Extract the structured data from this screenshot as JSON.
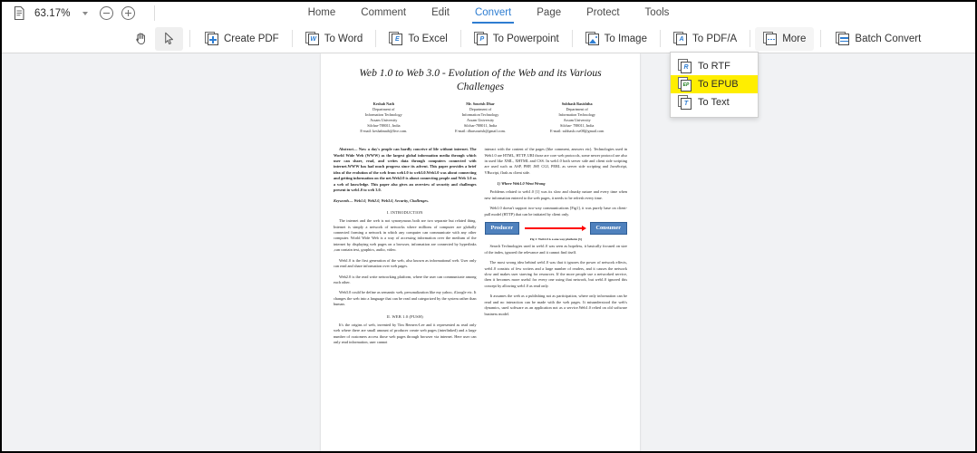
{
  "topbar": {
    "doc_icon": "document-icon",
    "zoom_level": "63.17%",
    "zoom_dropdown_icon": "chevron-down-icon",
    "zoom_out_icon": "zoom-out-icon",
    "zoom_in_icon": "zoom-in-icon",
    "menu": [
      {
        "label": "Home",
        "active": false
      },
      {
        "label": "Comment",
        "active": false
      },
      {
        "label": "Edit",
        "active": false
      },
      {
        "label": "Convert",
        "active": true
      },
      {
        "label": "Page",
        "active": false
      },
      {
        "label": "Protect",
        "active": false
      },
      {
        "label": "Tools",
        "active": false
      }
    ]
  },
  "ribbon": {
    "hand_tool": "hand-tool-icon",
    "select_tool": "select-pointer-icon",
    "buttons": [
      {
        "label": "Create PDF",
        "icon": "create-pdf-icon",
        "glyph": "+"
      },
      {
        "label": "To Word",
        "icon": "to-word-icon",
        "glyph": "W"
      },
      {
        "label": "To Excel",
        "icon": "to-excel-icon",
        "glyph": "E"
      },
      {
        "label": "To Powerpoint",
        "icon": "to-powerpoint-icon",
        "glyph": "P"
      },
      {
        "label": "To Image",
        "icon": "to-image-icon",
        "glyph": "img"
      },
      {
        "label": "To PDF/A",
        "icon": "to-pdfa-icon",
        "glyph": "A"
      },
      {
        "label": "More",
        "icon": "more-icon",
        "glyph": "dots"
      },
      {
        "label": "Batch Convert",
        "icon": "batch-convert-icon",
        "glyph": "swap"
      }
    ]
  },
  "dropdown": {
    "open": true,
    "items": [
      {
        "label": "To RTF",
        "icon": "to-rtf-icon",
        "glyph": "R",
        "highlighted": false
      },
      {
        "label": "To EPUB",
        "icon": "to-epub-icon",
        "glyph": "EP",
        "highlighted": true
      },
      {
        "label": "To Text",
        "icon": "to-text-icon",
        "glyph": "T",
        "highlighted": false
      }
    ],
    "highlight_color": "#ffee00"
  },
  "document": {
    "title": "Web 1.0 to Web 3.0 - Evolution of the Web and its Various Challenges",
    "authors": [
      {
        "name": "Keshab Nath",
        "dept1": "Department of",
        "dept2": "Information Technology",
        "university": "Assam University",
        "address": "Silchar-788011, India",
        "email": "E-mail: keshabnath@live.com."
      },
      {
        "name": "Mr. Sourish Dhar",
        "dept1": "Department of",
        "dept2": "Information Technology",
        "university": "Assam University",
        "address": "Silchar-788011, India",
        "email": "E-mail: dharsourish@gmail.com."
      },
      {
        "name": "Subhash Basishtha",
        "dept1": "Department of",
        "dept2": "Information Technology",
        "university": "Assam University",
        "address": "Silchar- 788011, India",
        "email": "E-mail: subhash.cse08@gmail.com"
      }
    ],
    "abstract": "Abstract— Now a day's people can hardly conceive of life without internet. The World Wide Web (WWW) as the largest global information media through which user can share, read, and writes data through computers connected with internet.WWW has had much progress since its advent. This paper provides a brief idea of the evolution of the web from web1.0 to web3.0.Web1.0 was about connecting and getting information on the net.Web2.0 is about connecting people and Web 3.0 as a web of knowledge. This paper also gives an overview of security and challenges present in web1.0 to web 3.0.",
    "keywords": "Keywords— Web1.0, Web2.0, Web3.0, Security, Challenges.",
    "section1": "I.     INTRODUCTION",
    "left_paras": [
      "The internet and the web is not synonymous both are two separate but related thing. Internet is simply a network of networks where millions of computer are globally connected forming a network in which any computer can communicate with any other computer. World Wide Web is a way of accessing information over the medium of the internet by displaying web pages on a browser, information are connected by hyperlinks ,can contain text, graphics, audio, video.",
      "Web1.0 is the first generation of the web, also known as informational web. User only can read and share information over web pages.",
      "Web2.0 is the read write networking platform, where the user can communicate among each other.",
      "Web3.0 could be define as semantic web, personalization like my yahoo, iGoogle etc. It changes the web into a language that can be read and categorized by the system rather than human."
    ],
    "section2": "II.     WEB 1.0 (PUSH)",
    "left_paras_2": [
      "It's the origins of web, invented by Tim Berners-Lee and it represented as read only web where there are small amount of producer create web pages (interlinked) and a large number of customers access those web pages through browser via internet. Here user can only read information, user cannot"
    ],
    "right_paras_1": [
      "interact with the content of the pages (like comment, answers etc). Technologies used in Web1.0 are HTML, HTTP, URI those are core web protocols, some newer protocol are also in used like XML, XHTML and CSS. In web1.0 both server side and client side scripting are used such as ASP, PHP, JSP, CGI, PERL as server side scripting and JavaScript, VBscript, flash as client side."
    ],
    "subsection1": "1)    Where Web1.0 Went Wrong",
    "right_paras_2": [
      "Problems related to web1.0 [1] was its slow and chunky nature and every time when new information entered to the web pages, it needs to be refresh every time.",
      "Web1.0 doesn't support two-way communications [Fig1], it was purely base on client-pull model (HTTP) that can be initiated by client only."
    ],
    "figure": {
      "left_box": "Producer",
      "right_box": "Consumer",
      "arrow": "right-arrow-icon",
      "caption": "Fig 1: Web1.0 is a one-way platform [3]"
    },
    "right_paras_3": [
      "Search Technologies used in web1.0 was seen as hopeless, it basically focused on size of the index, ignored the relevance and it cannot find itself.",
      "The most wrong idea behind web1.0 was that it ignores the power of network effects, web1.0 consists of few writers and a large number of readers, and it causes the network slow and makes user starving for resources. If the more people use a networked service, then it becomes more useful for every one using that network, but web1.0 ignored this concept by allowing web1.0 as read only.",
      "It assumes the web as a publishing not as participation, where only information can be read and no interaction can be made with the web pages. It misunderstood the web's dynamics, used software as an application not as a service.Web1.0 relied on old software business model."
    ]
  }
}
